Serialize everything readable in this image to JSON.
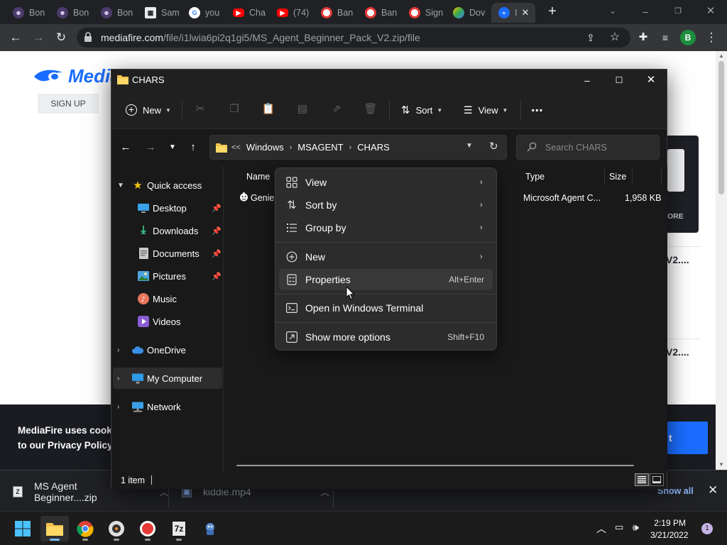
{
  "browser": {
    "tabs": [
      {
        "label": "Bon",
        "favicon": "ghost-icon",
        "color": "#c58af9"
      },
      {
        "label": "Bon",
        "favicon": "ghost-icon",
        "color": "#c58af9"
      },
      {
        "label": "Bon",
        "favicon": "ghost-icon",
        "color": "#c58af9"
      },
      {
        "label": "Sam",
        "favicon": "grid-icon",
        "color": "#e8eaed"
      },
      {
        "label": "you",
        "favicon": "google-icon",
        "color": "#4285f4"
      },
      {
        "label": "Cha",
        "favicon": "youtube-icon",
        "color": "#ff0000"
      },
      {
        "label": "(74)",
        "favicon": "youtube-icon",
        "color": "#ff0000"
      },
      {
        "label": "Ban",
        "favicon": "record-icon",
        "color": "#ff3b30"
      },
      {
        "label": "Ban",
        "favicon": "record-icon",
        "color": "#ff3b30"
      },
      {
        "label": "Sign",
        "favicon": "record-icon",
        "color": "#ff3b30"
      },
      {
        "label": "Dov",
        "favicon": "colorful-icon",
        "color": "#fbbc04"
      },
      {
        "label": "I",
        "favicon": "mediafire-icon",
        "color": "#1a6dff",
        "active": true
      }
    ],
    "new_tab_symbol": "+",
    "url_domain": "mediafire.com",
    "url_path": "/file/i1lwia6pi2q1gi5/MS_Agent_Beginner_Pack_V2.zip/file",
    "profile_initial": "B"
  },
  "webpage": {
    "logo_text": "Media",
    "signup_label": "SIGN UP",
    "side_more_label": "ORE",
    "card1_text": "V2....",
    "card2_text": "V2....",
    "cookie_line1": "MediaFire uses cookie",
    "cookie_line2": "to our Privacy Policy.",
    "cookie_button": "t"
  },
  "explorer": {
    "title": "CHARS",
    "cmd": {
      "new_label": "New",
      "sort_label": "Sort",
      "view_label": "View",
      "more_label": "..."
    },
    "breadcrumb": {
      "overflow": "<<",
      "parts": [
        "Windows",
        "MSAGENT",
        "CHARS"
      ]
    },
    "search_placeholder": "Search CHARS",
    "nav": {
      "quick_access": "Quick access",
      "desktop": "Desktop",
      "downloads": "Downloads",
      "documents": "Documents",
      "pictures": "Pictures",
      "music": "Music",
      "videos": "Videos",
      "onedrive": "OneDrive",
      "my_computer": "My Computer",
      "network": "Network"
    },
    "columns": {
      "name": "Name",
      "type": "Type",
      "size": "Size"
    },
    "files": [
      {
        "name": "Genie.",
        "type": "Microsoft Agent C...",
        "size": "1,958 KB"
      }
    ],
    "status_count": "1 item"
  },
  "context_menu": {
    "view": "View",
    "sort_by": "Sort by",
    "group_by": "Group by",
    "new": "New",
    "properties": "Properties",
    "properties_shortcut": "Alt+Enter",
    "open_terminal": "Open in Windows Terminal",
    "show_more": "Show more options",
    "show_more_shortcut": "Shift+F10"
  },
  "downloads_bar": {
    "items": [
      {
        "name": "MS Agent Beginner....zip",
        "icon": "7z-archive-icon"
      },
      {
        "name": "kiddie.mp4",
        "icon": "video-file-icon"
      }
    ],
    "show_all": "Show all"
  },
  "taskbar": {
    "time": "2:19 PM",
    "date": "3/21/2022",
    "notification_count": "1",
    "sevenzip_label": "7z"
  }
}
